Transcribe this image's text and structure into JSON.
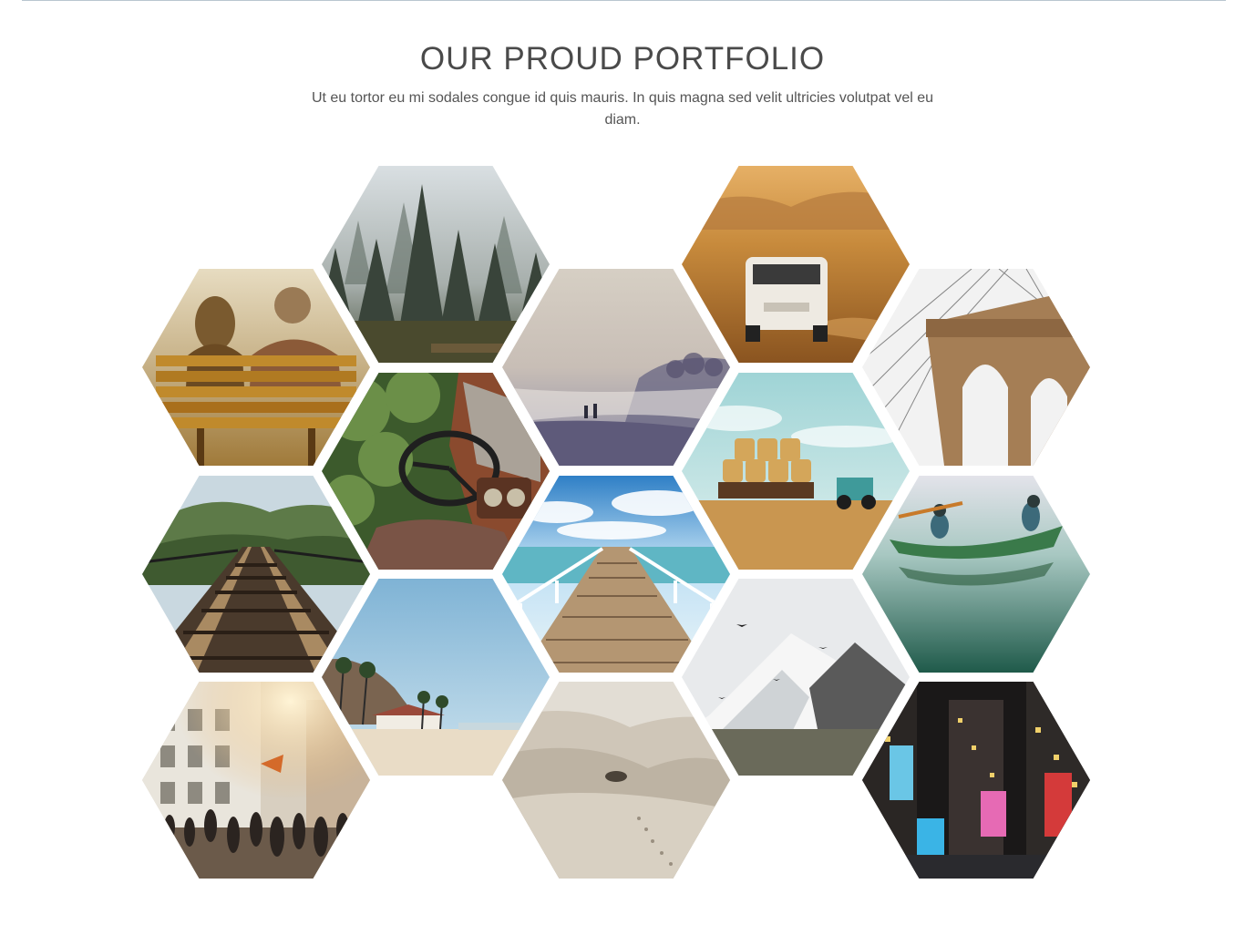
{
  "section": {
    "title": "OUR PROUD PORTFOLIO",
    "subtitle": "Ut eu tortor eu mi sodales congue id quis mauris. In quis magna sed velit ultricies volutpat vel eu diam."
  },
  "colors": {
    "title": "#4a4a4a",
    "text": "#555555",
    "rule": "#b9c6cf"
  },
  "portfolio": {
    "items": [
      "couple-on-bench",
      "misty-forest",
      "misty-beach",
      "van-in-desert",
      "brooklyn-bridge",
      "car-interior",
      "hay-tractor",
      "railway-tracks",
      "wooden-pier",
      "canoe-on-lake",
      "palm-beach",
      "snowy-mountain",
      "city-street",
      "sand-dunes",
      "city-night"
    ]
  }
}
